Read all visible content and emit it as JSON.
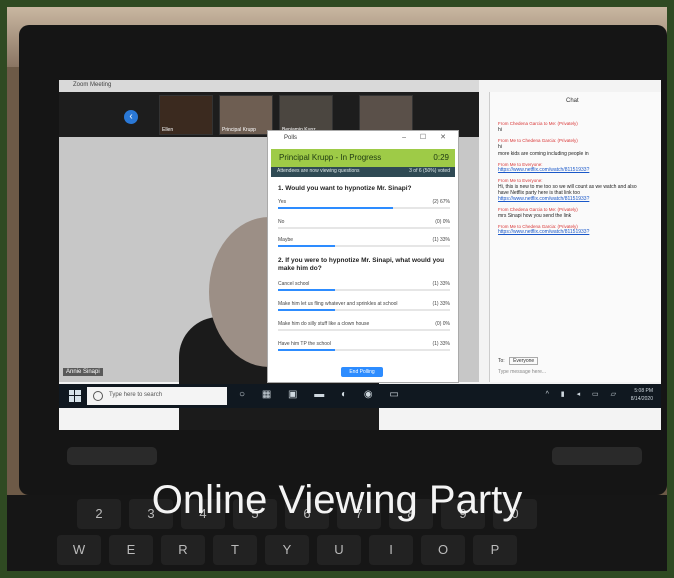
{
  "zoom": {
    "window_title": "Zoom Meeting",
    "thumbnails": [
      {
        "label": "Ellen"
      },
      {
        "label": "Principal Krupp"
      },
      {
        "label": "Benjamin Kunz"
      }
    ],
    "main_video_name": "Annie Sinapi"
  },
  "poll": {
    "window_title": "Polls",
    "window_controls": "– ☐ ✕",
    "host": "Principal Krupp - In Progress",
    "timer": "0:29",
    "note": "Attendees are now viewing questions",
    "count": "3 of 6 (50%) voted",
    "questions": [
      {
        "text": "1. Would you want to hypnotize Mr. Sinapi?",
        "options": [
          {
            "label": "Yes",
            "pct": "(2) 67%",
            "value": 0.67
          },
          {
            "label": "No",
            "pct": "(0) 0%",
            "value": 0.0
          },
          {
            "label": "Maybe",
            "pct": "(1) 33%",
            "value": 0.33
          }
        ]
      },
      {
        "text": "2. If you were to hypnotize Mr. Sinapi, what would you make him do?",
        "options": [
          {
            "label": "Cancel school",
            "pct": "(1) 33%",
            "value": 0.33
          },
          {
            "label": "Make him let us fling whatever and sprinkles at school",
            "pct": "(1) 33%",
            "value": 0.33
          },
          {
            "label": "Make him do silly stuff like a clown house",
            "pct": "(0) 0%",
            "value": 0.0
          },
          {
            "label": "Have him TP the school",
            "pct": "(1) 33%",
            "value": 0.33
          }
        ]
      }
    ],
    "end_button": "End Polling"
  },
  "chat": {
    "title": "Chat",
    "messages": [
      {
        "from": "From Chedena Garcia to Me: (Privately)",
        "text": "hi"
      },
      {
        "from": "From Me to Chedena Garcia: (Privately)",
        "text": "hi"
      },
      {
        "from": "",
        "text": "more kids are coming including people in"
      },
      {
        "from": "From Me to Everyone:",
        "link": "https://www.netflix.com/watch/81151933?"
      },
      {
        "from": "From Me to Everyone:",
        "text": "Hi, this is new to me too so we will count as we watch and also have Netflix party here is that link too",
        "link": "https://www.netflix.com/watch/81151933?"
      },
      {
        "from": "From Chedena Garcia to Me: (Privately)",
        "text": "mrs Sinapi how you send the link"
      },
      {
        "from": "From Me to Chedena Garcia: (Privately)",
        "link": "https://www.netflix.com/watch/81151933?"
      }
    ],
    "to_label": "To:",
    "to_value": "Everyone",
    "input_placeholder": "Type message here..."
  },
  "taskbar": {
    "search_placeholder": "Type here to search",
    "time": "5:08 PM",
    "date": "8/14/2020"
  },
  "keyboard_keys": [
    "2",
    "3",
    "4",
    "5",
    "6",
    "7",
    "8",
    "9",
    "0",
    "W",
    "E",
    "R",
    "T",
    "Y",
    "U",
    "I",
    "O",
    "P"
  ],
  "caption": "Online Viewing Party"
}
